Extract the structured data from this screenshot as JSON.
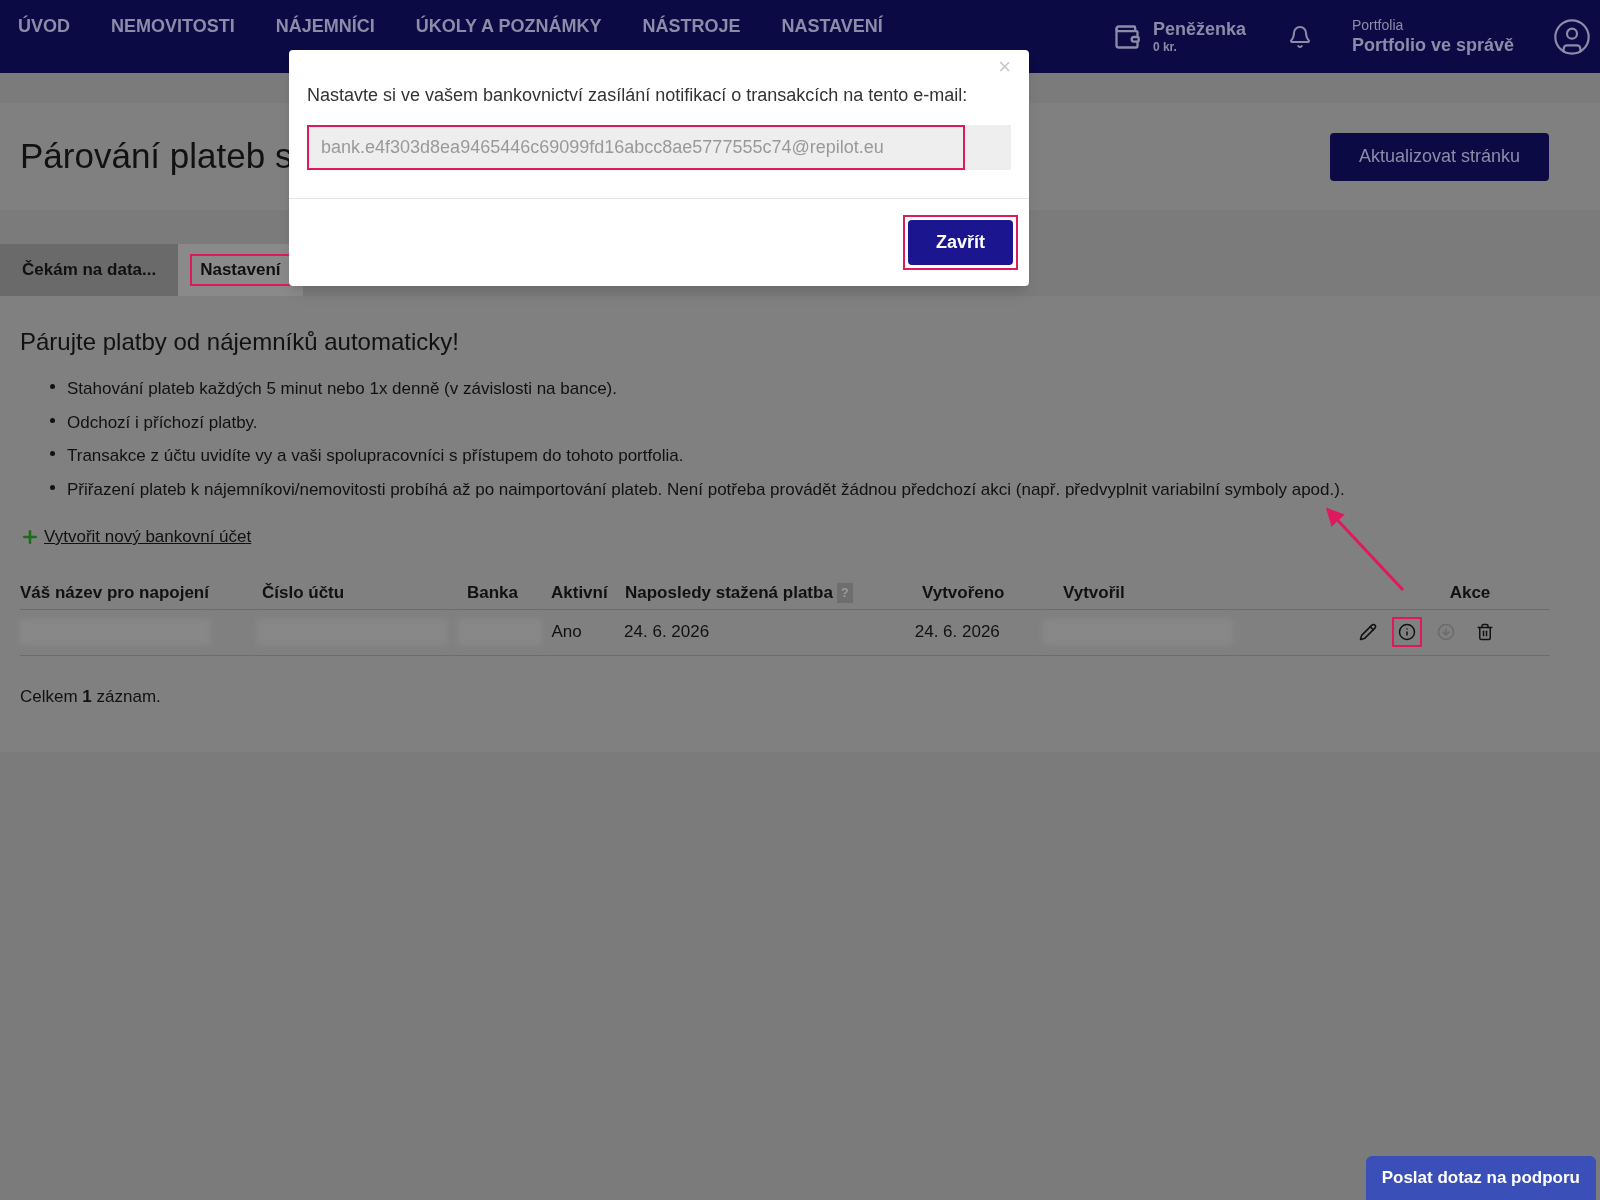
{
  "nav": {
    "items": [
      {
        "label": "ÚVOD"
      },
      {
        "label": "NEMOVITOSTI"
      },
      {
        "label": "NÁJEMNÍCI"
      },
      {
        "label": "ÚKOLY A POZNÁMKY"
      },
      {
        "label": "NÁSTROJE"
      },
      {
        "label": "NASTAVENÍ"
      }
    ],
    "wallet": {
      "label": "Peněženka",
      "amount": "0 kr."
    },
    "portfolio": {
      "label": "Portfolia",
      "name": "Portfolio ve správě"
    }
  },
  "page": {
    "title": "Párování plateb s",
    "refresh_button": "Aktualizovat stránku"
  },
  "tabs": [
    {
      "label": "Čekám na data...",
      "selected": false,
      "highlighted": false
    },
    {
      "label": "Nastavení",
      "selected": true,
      "highlighted": true
    }
  ],
  "intro": {
    "heading": "Párujte platby od nájemníků automaticky!",
    "bullets": [
      "Stahování plateb každých 5 minut nebo 1x denně (v závislosti na bance).",
      "Odchozí i příchozí platby.",
      "Transakce z účtu uvidíte vy a vaši spolupracovníci s přístupem do tohoto portfolia.",
      "Přiřazení plateb k nájemníkovi/nemovitosti probíhá až po naimportování plateb. Není potřeba provádět žádnou předchozí akci (např. předvyplnit variabilní symboly apod.)."
    ],
    "create_link": "Vytvořit nový bankovní účet"
  },
  "table": {
    "columns": [
      {
        "label": "Váš název pro napojení"
      },
      {
        "label": "Číslo účtu"
      },
      {
        "label": "Banka"
      },
      {
        "label": "Aktivní"
      },
      {
        "label": "Naposledy stažená platba",
        "help": "?"
      },
      {
        "label": "Vytvořeno"
      },
      {
        "label": "Vytvořil"
      },
      {
        "label": "Akce"
      }
    ],
    "rows": [
      {
        "cells": [
          {
            "kind": "redacted"
          },
          {
            "kind": "redacted"
          },
          {
            "kind": "redacted"
          },
          {
            "kind": "text",
            "text": "Ano"
          },
          {
            "kind": "text",
            "text": "24. 6. 2026"
          },
          {
            "kind": "text",
            "text": "24. 6. 2026"
          },
          {
            "kind": "redacted"
          }
        ],
        "actions": [
          {
            "kind": "edit",
            "highlighted": false,
            "disabled": false
          },
          {
            "kind": "info",
            "highlighted": true,
            "disabled": false
          },
          {
            "kind": "download",
            "highlighted": false,
            "disabled": true
          },
          {
            "kind": "delete",
            "highlighted": false,
            "disabled": false
          }
        ]
      }
    ]
  },
  "summary": "Celkem **1** záznam.",
  "modal": {
    "close": "×",
    "message": "Nastavte si ve vašem bankovnictví zasílání notifikací o transakcích na tento e-mail:",
    "email": "bank.e4f303d8ea9465446c69099fd16abcc8ae5777555c74@repilot.eu",
    "button": "Zavřít"
  },
  "support_button": "Poslat dotaz na podporu"
}
